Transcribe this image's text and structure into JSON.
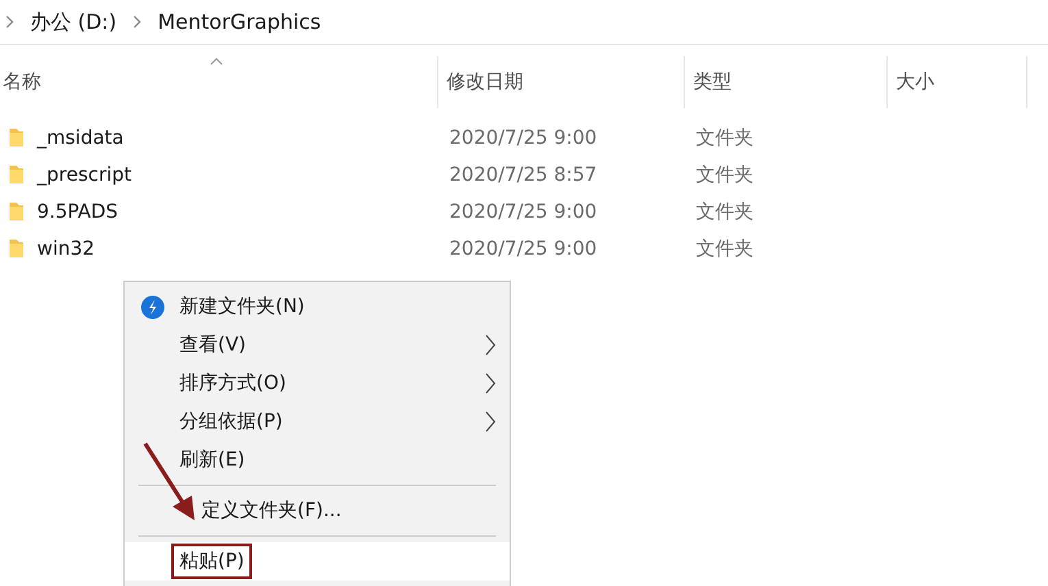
{
  "breadcrumb": [
    "办公 (D:)",
    "MentorGraphics"
  ],
  "table": {
    "columns": [
      {
        "label": "名称",
        "sorted": true
      },
      {
        "label": "修改日期",
        "sorted": false
      },
      {
        "label": "类型",
        "sorted": false
      },
      {
        "label": "大小",
        "sorted": false
      }
    ],
    "rows": [
      {
        "name": "_msidata",
        "date": "2020/7/25 9:00",
        "type": "文件夹"
      },
      {
        "name": "_prescript",
        "date": "2020/7/25 8:57",
        "type": "文件夹"
      },
      {
        "name": "9.5PADS",
        "date": "2020/7/25 9:00",
        "type": "文件夹"
      },
      {
        "name": "win32",
        "date": "2020/7/25 9:00",
        "type": "文件夹"
      }
    ]
  },
  "context_menu": [
    {
      "kind": "item",
      "label": "新建文件夹(N)",
      "icon": true,
      "submenu": false,
      "highlighted": false
    },
    {
      "kind": "item",
      "label": "查看(V)",
      "icon": false,
      "submenu": true,
      "highlighted": false
    },
    {
      "kind": "item",
      "label": "排序方式(O)",
      "icon": false,
      "submenu": true,
      "highlighted": false
    },
    {
      "kind": "item",
      "label": "分组依据(P)",
      "icon": false,
      "submenu": true,
      "highlighted": false
    },
    {
      "kind": "item",
      "label": "刷新(E)",
      "icon": false,
      "submenu": false,
      "highlighted": false
    },
    {
      "kind": "separator"
    },
    {
      "kind": "item",
      "label": "定义文件夹(F)...",
      "icon": false,
      "submenu": false,
      "highlighted": false
    },
    {
      "kind": "separator"
    },
    {
      "kind": "item",
      "label": "粘贴(P)",
      "icon": false,
      "submenu": false,
      "highlighted": true
    }
  ]
}
